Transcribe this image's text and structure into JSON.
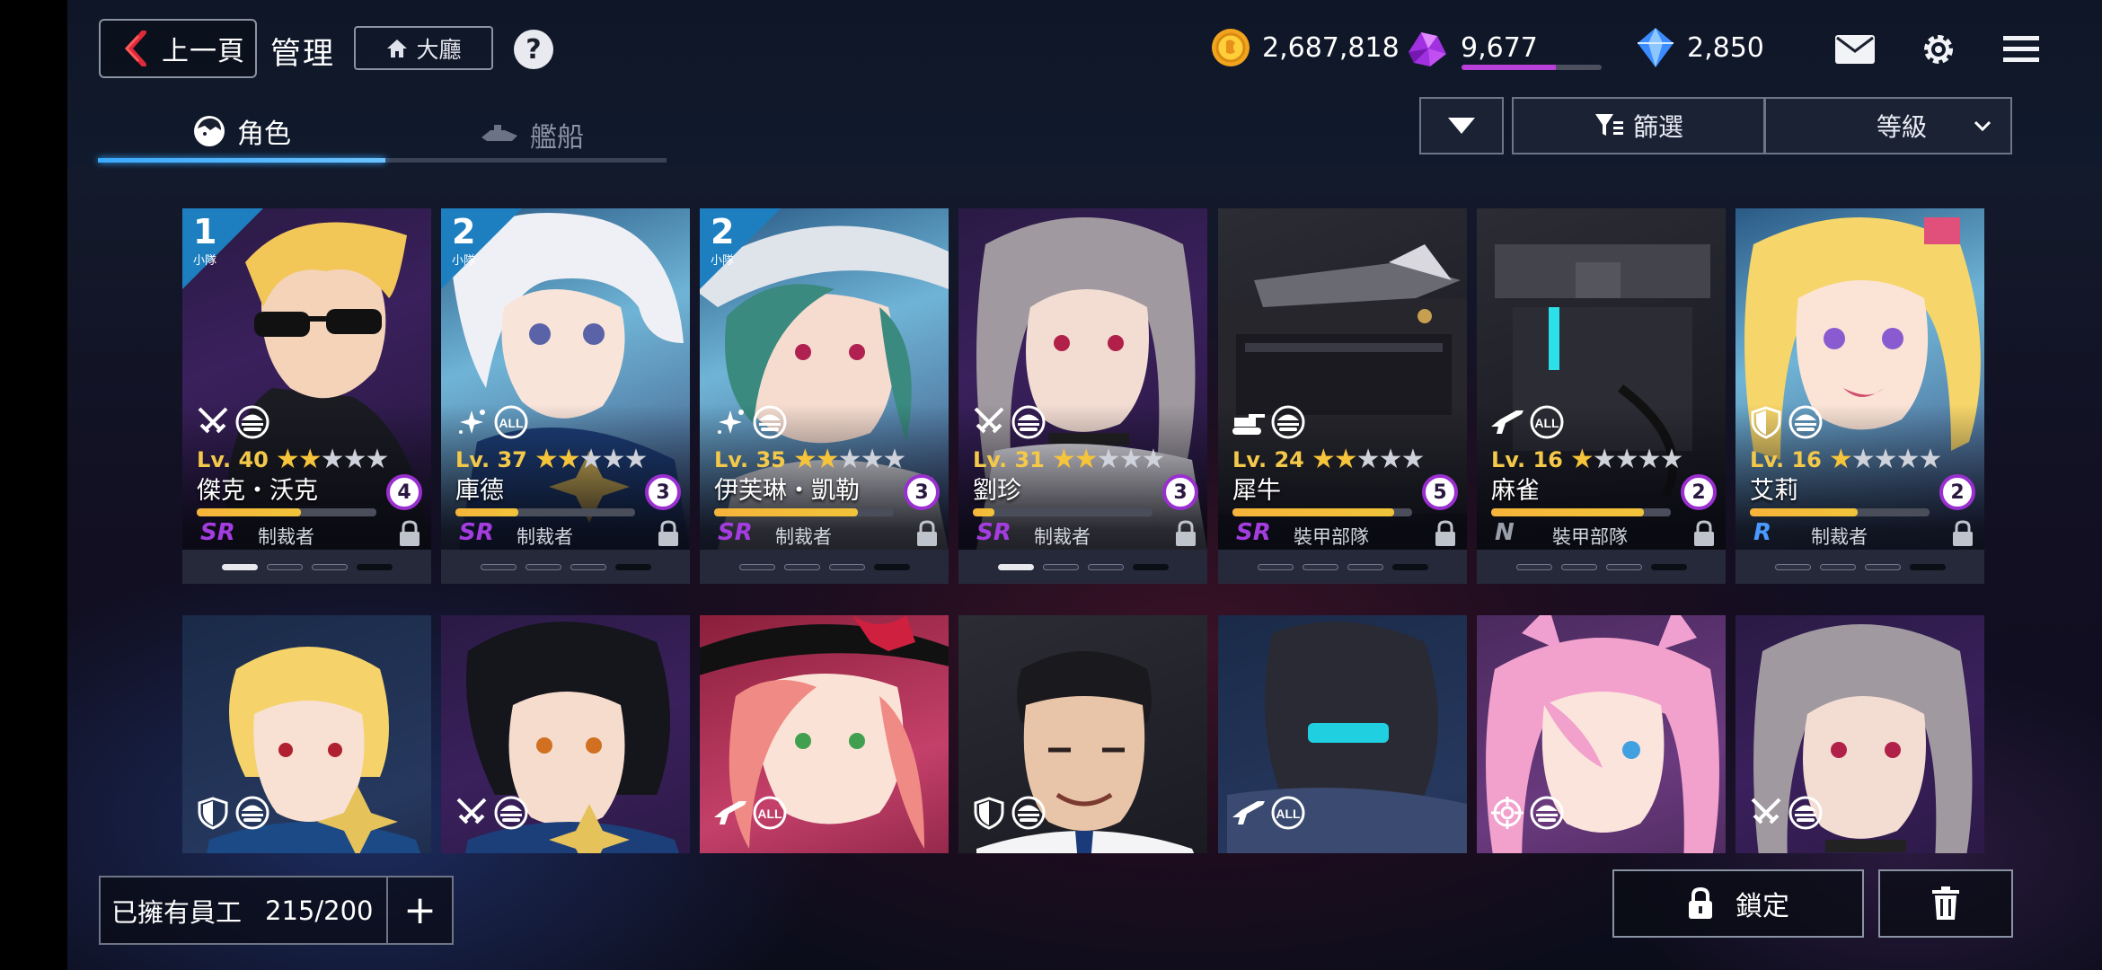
{
  "header": {
    "back_label": "上一頁",
    "title": "管理",
    "lobby_label": "大廳",
    "help_label": "?"
  },
  "currency": {
    "gold": "2,687,818",
    "crystal": "9,677",
    "crystal_progress": 0.67,
    "diamond": "2,850"
  },
  "top_icons": [
    "mail-icon",
    "gear-icon",
    "menu-icon"
  ],
  "tabs": [
    {
      "label": "角色",
      "active": true
    },
    {
      "label": "艦船",
      "active": false
    }
  ],
  "controls": {
    "filter_label": "篩選",
    "sort_label": "等級"
  },
  "cards": [
    {
      "squad": "1",
      "squad_sub": "小隊",
      "level": "Lv. 40",
      "stars": 2,
      "name": "傑克・沃克",
      "affinity": "4",
      "xp": 0.58,
      "rarity": "SR",
      "unit": "制裁者",
      "roles": [
        "sword-icon",
        "burger-icon"
      ],
      "pips": [
        1,
        0,
        0,
        2
      ]
    },
    {
      "squad": "2",
      "squad_sub": "小隊",
      "level": "Lv. 37",
      "stars": 2,
      "name": "庫德",
      "affinity": "3",
      "xp": 0.35,
      "rarity": "SR",
      "unit": "制裁者",
      "roles": [
        "sparkle-icon",
        "all-icon"
      ],
      "pips": [
        0,
        0,
        0,
        2
      ]
    },
    {
      "squad": "2",
      "squad_sub": "小隊",
      "level": "Lv. 35",
      "stars": 2,
      "name": "伊芙琳・凱勒",
      "affinity": "3",
      "xp": 0.8,
      "rarity": "SR",
      "unit": "制裁者",
      "roles": [
        "sparkle-icon",
        "burger-icon"
      ],
      "pips": [
        0,
        0,
        0,
        2
      ]
    },
    {
      "squad": "",
      "squad_sub": "",
      "level": "Lv. 31",
      "stars": 2,
      "name": "劉珍",
      "affinity": "3",
      "xp": 0.12,
      "rarity": "SR",
      "unit": "制裁者",
      "roles": [
        "sword-icon",
        "burger-icon"
      ],
      "pips": [
        1,
        0,
        0,
        2
      ]
    },
    {
      "squad": "",
      "squad_sub": "",
      "level": "Lv. 24",
      "stars": 2,
      "name": "犀牛",
      "affinity": "5",
      "xp": 0.9,
      "rarity": "SR",
      "unit": "裝甲部隊",
      "roles": [
        "tank-icon",
        "burger-icon"
      ],
      "pips": [
        0,
        0,
        0,
        2
      ]
    },
    {
      "squad": "",
      "squad_sub": "",
      "level": "Lv. 16",
      "stars": 1,
      "name": "麻雀",
      "affinity": "2",
      "xp": 0.85,
      "rarity": "N",
      "unit": "裝甲部隊",
      "roles": [
        "gun-icon",
        "all-icon"
      ],
      "pips": [
        0,
        0,
        0,
        2
      ]
    },
    {
      "squad": "",
      "squad_sub": "",
      "level": "Lv. 16",
      "stars": 1,
      "name": "艾莉",
      "affinity": "2",
      "xp": 0.6,
      "rarity": "R",
      "unit": "制裁者",
      "roles": [
        "shield-icon",
        "burger-icon"
      ],
      "pips": [
        0,
        0,
        0,
        2
      ]
    },
    {
      "roles": [
        "shield-icon",
        "burger-icon"
      ]
    },
    {
      "roles": [
        "sword-icon",
        "burger-icon"
      ]
    },
    {
      "roles": [
        "gun-icon",
        "all-icon"
      ]
    },
    {
      "roles": [
        "shield-icon",
        "burger-icon"
      ]
    },
    {
      "roles": [
        "gun-icon",
        "all-icon"
      ]
    },
    {
      "roles": [
        "target-icon",
        "burger-icon"
      ]
    },
    {
      "roles": [
        "sword-icon",
        "burger-icon"
      ]
    }
  ],
  "footer": {
    "owned_label": "已擁有員工",
    "owned_count": "215/200",
    "add_label": "+",
    "lock_label": "鎖定"
  },
  "colors": {
    "accent_blue": "#3aa9ff",
    "xp_orange": "#f7b43a",
    "sr_purple": "#a43de0",
    "affinity_ring": "#9a2fd0"
  }
}
